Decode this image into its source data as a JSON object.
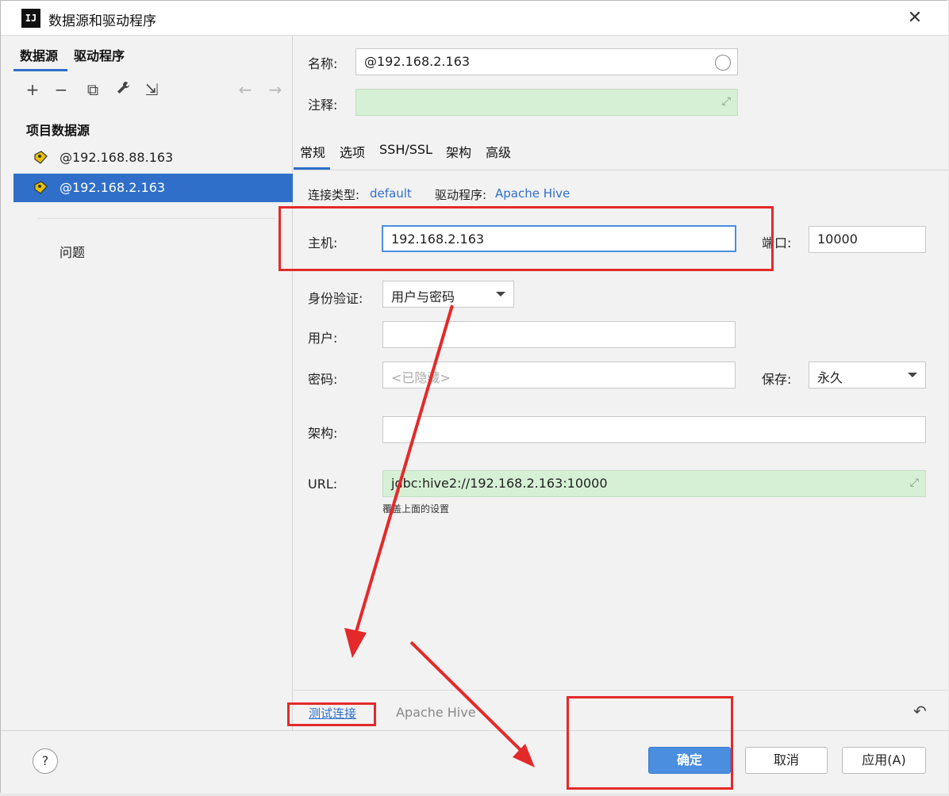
{
  "window": {
    "title": "数据源和驱动程序",
    "app_icon_text": "IJ",
    "close": "✕"
  },
  "left": {
    "tabs": [
      "数据源",
      "驱动程序"
    ],
    "toolbar": {
      "add": "+",
      "remove": "−",
      "copy": "⧉",
      "settings": "🔧",
      "import": "⇲",
      "back": "←",
      "forward": "→"
    },
    "section_title": "项目数据源",
    "items": [
      {
        "label": "@192.168.88.163",
        "selected": false
      },
      {
        "label": "@192.168.2.163",
        "selected": true
      }
    ],
    "problems": "问题"
  },
  "form": {
    "name_label": "名称:",
    "name_value": "@192.168.2.163",
    "comment_label": "注释:",
    "tabs": [
      "常规",
      "选项",
      "SSH/SSL",
      "架构",
      "高级"
    ],
    "conn_type_label": "连接类型:",
    "conn_type_value": "default",
    "driver_label": "驱动程序:",
    "driver_value": "Apache Hive",
    "host_label": "主机:",
    "host_value": "192.168.2.163",
    "port_label": "端口:",
    "port_value": "10000",
    "auth_label": "身份验证:",
    "auth_value": "用户与密码",
    "user_label": "用户:",
    "user_value": "",
    "password_label": "密码:",
    "password_placeholder": "<已隐藏>",
    "save_label": "保存:",
    "save_value": "永久",
    "schema_label": "架构:",
    "schema_value": "",
    "url_label": "URL:",
    "url_value": "jdbc:hive2://192.168.2.163:10000",
    "url_hint": "覆盖上面的设置"
  },
  "bottom": {
    "test_connection": "测试连接",
    "driver_status": "Apache Hive",
    "reset_icon": "↶"
  },
  "footer": {
    "help": "?",
    "ok": "确定",
    "cancel": "取消",
    "apply": "应用(A)"
  },
  "colors": {
    "accent": "#2f6fc9",
    "annotation": "#e4292a",
    "green_field": "#d6f0d6"
  }
}
